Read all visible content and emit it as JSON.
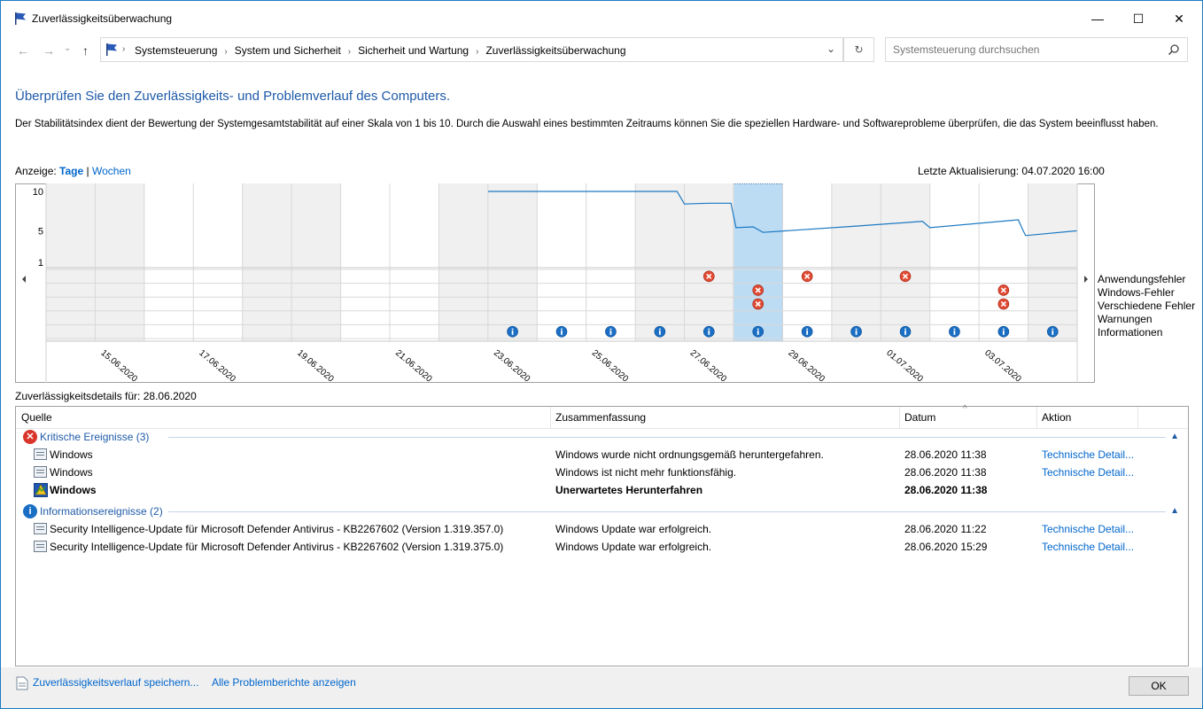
{
  "window": {
    "title": "Zuverlässigkeitsüberwachung",
    "minimize": "—",
    "maximize": "☐",
    "close": "✕"
  },
  "address": {
    "crumbs": [
      "Systemsteuerung",
      "System und Sicherheit",
      "Sicherheit und Wartung",
      "Zuverlässigkeitsüberwachung"
    ],
    "search_placeholder": "Systemsteuerung durchsuchen"
  },
  "page": {
    "heading": "Überprüfen Sie den Zuverlässigkeits- und Problemverlauf des Computers.",
    "description": "Der Stabilitätsindex dient der Bewertung der Systemgesamtstabilität auf einer Skala von 1 bis 10. Durch die Auswahl eines bestimmten Zeitraums können Sie die speziellen Hardware- und Softwareprobleme überprüfen, die das System beeinflusst haben.",
    "view_label": "Anzeige:",
    "view_days": "Tage",
    "view_sep": "|",
    "view_weeks": "Wochen",
    "last_update": "Letzte Aktualisierung: 04.07.2020 16:00",
    "details_for": "Zuverlässigkeitsdetails für: 28.06.2020"
  },
  "chart_data": {
    "type": "line",
    "title": "",
    "y_ticks": [
      "10",
      "5",
      "1"
    ],
    "ylim": [
      1,
      10
    ],
    "x_tick_labels": [
      "15.06.2020",
      "17.06.2020",
      "19.06.2020",
      "21.06.2020",
      "23.06.2020",
      "25.06.2020",
      "27.06.2020",
      "29.06.2020",
      "01.07.2020",
      "03.07.2020"
    ],
    "days": [
      "14.06.2020",
      "15.06.2020",
      "16.06.2020",
      "17.06.2020",
      "18.06.2020",
      "19.06.2020",
      "20.06.2020",
      "21.06.2020",
      "22.06.2020",
      "23.06.2020",
      "24.06.2020",
      "25.06.2020",
      "26.06.2020",
      "27.06.2020",
      "28.06.2020",
      "29.06.2020",
      "30.06.2020",
      "01.07.2020",
      "02.07.2020",
      "03.07.2020",
      "04.07.2020"
    ],
    "selected_day": "28.06.2020",
    "stability_index": [
      {
        "x": 9.0,
        "y": 10.0
      },
      {
        "x": 12.85,
        "y": 10.0
      },
      {
        "x": 13.0,
        "y": 8.4
      },
      {
        "x": 13.5,
        "y": 8.5
      },
      {
        "x": 13.95,
        "y": 8.5
      },
      {
        "x": 14.05,
        "y": 5.4
      },
      {
        "x": 14.4,
        "y": 5.5
      },
      {
        "x": 14.6,
        "y": 4.8
      },
      {
        "x": 16.5,
        "y": 5.6
      },
      {
        "x": 17.85,
        "y": 6.2
      },
      {
        "x": 18.0,
        "y": 5.4
      },
      {
        "x": 19.8,
        "y": 6.4
      },
      {
        "x": 19.9,
        "y": 5.0
      },
      {
        "x": 19.95,
        "y": 4.4
      },
      {
        "x": 21.0,
        "y": 5.0
      }
    ],
    "row_labels": [
      "Anwendungsfehler",
      "Windows-Fehler",
      "Verschiedene Fehler",
      "Warnungen",
      "Informationen"
    ],
    "events": [
      {
        "row": 0,
        "day": 13,
        "kind": "error"
      },
      {
        "row": 0,
        "day": 15,
        "kind": "error"
      },
      {
        "row": 0,
        "day": 17,
        "kind": "error"
      },
      {
        "row": 1,
        "day": 14,
        "kind": "error"
      },
      {
        "row": 1,
        "day": 19,
        "kind": "error"
      },
      {
        "row": 2,
        "day": 14,
        "kind": "error"
      },
      {
        "row": 2,
        "day": 19,
        "kind": "error"
      },
      {
        "row": 4,
        "day": 9,
        "kind": "info"
      },
      {
        "row": 4,
        "day": 10,
        "kind": "info"
      },
      {
        "row": 4,
        "day": 11,
        "kind": "info"
      },
      {
        "row": 4,
        "day": 12,
        "kind": "info"
      },
      {
        "row": 4,
        "day": 13,
        "kind": "info"
      },
      {
        "row": 4,
        "day": 14,
        "kind": "info"
      },
      {
        "row": 4,
        "day": 15,
        "kind": "info"
      },
      {
        "row": 4,
        "day": 16,
        "kind": "info"
      },
      {
        "row": 4,
        "day": 17,
        "kind": "info"
      },
      {
        "row": 4,
        "day": 18,
        "kind": "info"
      },
      {
        "row": 4,
        "day": 19,
        "kind": "info"
      },
      {
        "row": 4,
        "day": 20,
        "kind": "info"
      }
    ],
    "colors": {
      "line": "#1a78c2",
      "selected": "#bcdcf4",
      "shaded": "#f0f0f0",
      "error": "#e04a33",
      "info": "#1a6fc4"
    }
  },
  "list": {
    "columns": {
      "source": "Quelle",
      "summary": "Zusammenfassung",
      "date": "Datum",
      "action": "Aktion"
    },
    "groups": [
      {
        "label": "Kritische Ereignisse (3)",
        "icon": "error-icon",
        "rows": [
          {
            "source": "Windows",
            "summary": "Windows wurde nicht ordnungsgemäß heruntergefahren.",
            "date": "28.06.2020 11:38",
            "action": "Technische Detail...",
            "bold": false,
            "icon": "report-icon"
          },
          {
            "source": "Windows",
            "summary": "Windows ist nicht mehr funktionsfähig.",
            "date": "28.06.2020 11:38",
            "action": "Technische Detail...",
            "bold": false,
            "icon": "report-icon"
          },
          {
            "source": "Windows",
            "summary": "Unerwartetes Herunterfahren",
            "date": "28.06.2020 11:38",
            "action": "",
            "bold": true,
            "icon": "shutdown-warning-icon"
          }
        ]
      },
      {
        "label": "Informationsereignisse (2)",
        "icon": "info-icon",
        "rows": [
          {
            "source": "Security Intelligence-Update für Microsoft Defender Antivirus - KB2267602 (Version 1.319.357.0)",
            "summary": "Windows Update war erfolgreich.",
            "date": "28.06.2020 11:22",
            "action": "Technische Detail...",
            "bold": false,
            "icon": "report-icon"
          },
          {
            "source": "Security Intelligence-Update für Microsoft Defender Antivirus - KB2267602 (Version 1.319.375.0)",
            "summary": "Windows Update war erfolgreich.",
            "date": "28.06.2020 15:29",
            "action": "Technische Detail...",
            "bold": false,
            "icon": "report-icon"
          }
        ]
      }
    ]
  },
  "footer": {
    "save_history": "Zuverlässigkeitsverlauf speichern...",
    "show_reports": "Alle Problemberichte anzeigen",
    "ok": "OK"
  }
}
